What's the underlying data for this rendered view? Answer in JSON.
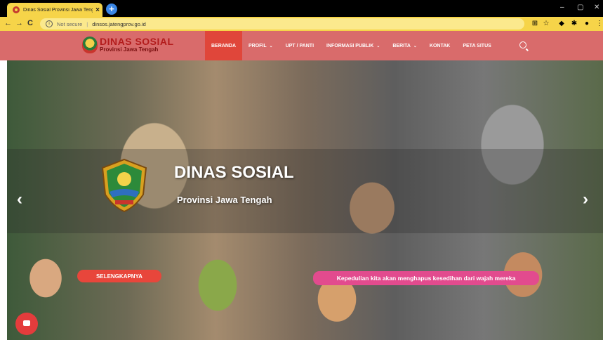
{
  "browser": {
    "tab_title": "Dinas Sosial Provinsi Jawa Tengah",
    "tab_close": "×",
    "new_tab": "+",
    "win_min": "–",
    "win_max": "▢",
    "win_close": "✕",
    "back": "←",
    "forward": "→",
    "reload": "C",
    "security_label": "Not secure",
    "url": "dinsos.jatengprov.go.id"
  },
  "site": {
    "brand_title": "DINAS SOSIAL",
    "brand_subtitle": "Provinsi Jawa Tengah",
    "menu": [
      {
        "label": "BERANDA",
        "active": true,
        "has_dropdown": false
      },
      {
        "label": "PROFIL",
        "active": false,
        "has_dropdown": true
      },
      {
        "label": "UPT / PANTI",
        "active": false,
        "has_dropdown": false
      },
      {
        "label": "INFORMASI PUBLIK",
        "active": false,
        "has_dropdown": true
      },
      {
        "label": "BERITA",
        "active": false,
        "has_dropdown": true
      },
      {
        "label": "KONTAK",
        "active": false,
        "has_dropdown": false
      },
      {
        "label": "PETA SITUS",
        "active": false,
        "has_dropdown": false
      }
    ],
    "caret": "⌄"
  },
  "hero": {
    "title": "DINAS SOSIAL",
    "subtitle": "Provinsi Jawa Tengah",
    "button_label": "SELENGKAPNYA",
    "tagline": "Kepedulian kita akan menghapus kesedihan dari wajah mereka",
    "prev": "‹",
    "next": "›"
  },
  "colors": {
    "chrome_yellow": "#f6d449",
    "header_bg": "#d96b6b",
    "active_menu": "#e0463a",
    "button_red": "#e8463b",
    "tagline_pink": "#e24b8e"
  }
}
